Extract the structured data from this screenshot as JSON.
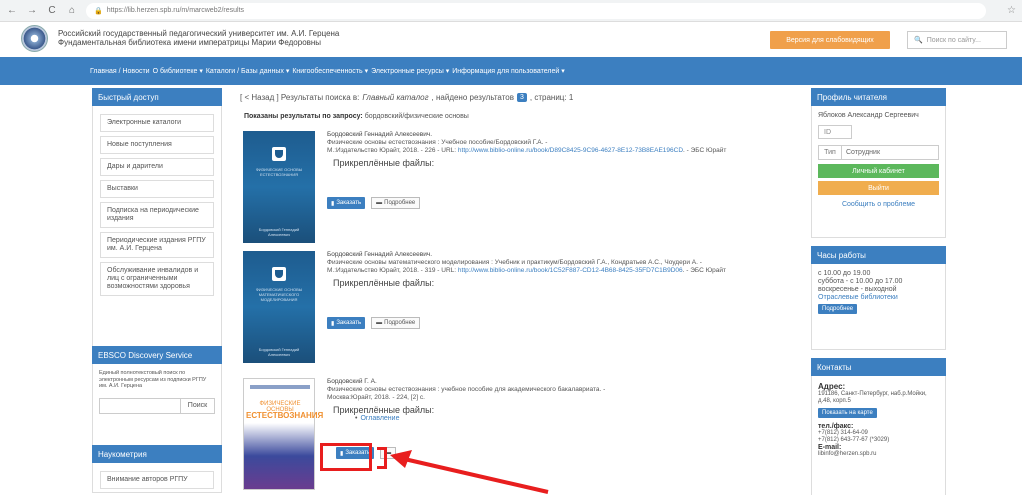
{
  "browser": {
    "back": "←",
    "forward": "→",
    "reload": "C",
    "home": "⌂",
    "url": "https://lib.herzen.spb.ru/m/marcweb2/results",
    "star": "☆"
  },
  "header": {
    "title_line1": "Российский государственный педагогический университет им. А.И. Герцена",
    "title_line2": "Фундаментальная библиотека имени императрицы Марии Федоровны",
    "visually_impaired": "Версия для слабовидящих",
    "search_placeholder": "Поиск по сайту..."
  },
  "nav": {
    "items": [
      "Главная / Новости",
      "О библиотеке ▾",
      "Каталоги / Базы данных ▾",
      "Книгообеспеченность ▾",
      "Электронные ресурсы ▾",
      "Информация для пользователей ▾"
    ]
  },
  "quick_access": {
    "title": "Быстрый доступ",
    "items": [
      "Электронные каталоги",
      "Новые поступления",
      "Дары и дарители",
      "Выставки",
      "Подписка на периодические издания",
      "Периодические издания РГПУ им. А.И. Герцена",
      "Обслуживание инвалидов и лиц с ограниченными возможностями здоровья"
    ]
  },
  "ebsco": {
    "title": "EBSCO Discovery Service",
    "description": "Единый полнотекстовый поиск по электронным ресурсам из подписки РГПУ им. А.И. Герцена",
    "search_button": "Поиск"
  },
  "scientometrics": {
    "title": "Наукометрия",
    "item": "Внимание авторов РГПУ"
  },
  "results": {
    "prefix": "[ < Назад ] Результаты поиска в:",
    "catalog": "Главный каталог",
    "found_label": ", найдено результатов",
    "count": "3",
    "pages_label": ", страниц: 1",
    "query_label": "Показаны результаты по запросу:",
    "query": "бордовский/физические основы"
  },
  "records": [
    {
      "author": "Бордовский Геннадий Алексеевич.",
      "title": "Физические основы естествознания : Учебное пособие/Бордовский Г.А. -",
      "publisher": "М.:Издательство Юрайт, 2018. - 226 - URL:",
      "url": "http://www.biblio-online.ru/book/D89C8425-9C96-4627-8E12-73B8EAE196CD",
      "suffix": ". - ЭБС Юрайт",
      "attached": "Прикреплённые файлы:",
      "cover_title": "ФИЗИЧЕСКИЕ ОСНОВЫ ЕСТЕСТВОЗНАНИЯ",
      "cover_author": "Бордовский Геннадий Алексеевич"
    },
    {
      "author": "Бордовский Геннадий Алексеевич.",
      "title": "Физические основы математического моделирования : Учебник и практикум/Бордовский Г.А., Кондратьев А.С., Чоудери А. -",
      "publisher": "М.:Издательство Юрайт, 2018. - 319 - URL:",
      "url": "http://www.biblio-online.ru/book/1C52F887-CD12-4B68-8425-35FD7C1B9D06",
      "suffix": ". - ЭБС Юрайт",
      "attached": "Прикреплённые файлы:",
      "cover_title": "ФИЗИЧЕСКИЕ ОСНОВЫ МАТЕМАТИЧЕСКОГО МОДЕЛИРОВАНИЯ",
      "cover_author": "Бордовский Геннадий Алексеевич"
    },
    {
      "author": "Бордовский Г. А.",
      "title": "Физические основы естествознания : учебное пособие для академического бакалавриата. -",
      "publisher": "Москва:Юрайт, 2018. - 224, [2] с.",
      "attached": "Прикреплённые файлы:",
      "attached_link": "Оглавление",
      "cover_t1": "ФИЗИЧЕСКИЕ ОСНОВЫ",
      "cover_t2": "ЕСТЕСТВОЗНАНИЯ"
    }
  ],
  "buttons": {
    "order": "Заказать",
    "details": "Подробнее"
  },
  "reader": {
    "title": "Профиль читателя",
    "name": "Яблоков Александр Сергеевич",
    "id": "ID",
    "type_label": "Тип",
    "type_value": "Сотрудник",
    "cabinet": "Личный кабинет",
    "logout": "Выйти",
    "report": "Сообщить о проблеме"
  },
  "hours": {
    "title": "Часы работы",
    "line1": "с 10.00 до 19.00",
    "line2": "суббота - с 10.00 до 17.00",
    "line3": "воскресенье - выходной",
    "link": "Отраслевые библиотеки",
    "more": "Подробнее"
  },
  "contacts": {
    "title": "Контакты",
    "address_label": "Адрес:",
    "address": "191186, Санкт-Петербург, наб.р.Мойки, д.48, корп.5",
    "map_btn": "Показать на карте",
    "phone_label": "тел./факс:",
    "phone1": "+7(812) 314-64-09",
    "phone2": "+7(812) 643-77-67 (*3029)",
    "email_label": "E-mail:",
    "email": "libinfo@herzen.spb.ru"
  },
  "colors": {
    "primary": "#3c7fc0",
    "highlight": "#e81e1e",
    "orange": "#f0a04b",
    "green": "#5cb85c"
  }
}
